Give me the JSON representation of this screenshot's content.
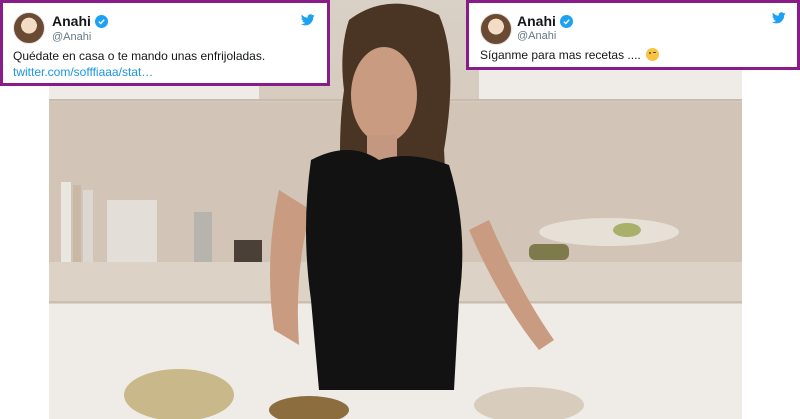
{
  "tweets": [
    {
      "name": "Anahi",
      "handle": "@Anahi",
      "text": "Quédate en casa o te mando unas enfrijoladas.",
      "link": "twitter.com/sofffiaaa/stat…"
    },
    {
      "name": "Anahi",
      "handle": "@Anahi",
      "text": "Síganme para mas recetas ....",
      "emoji": "relieved-face-emoji"
    }
  ],
  "colors": {
    "frame": "#8a1c8a",
    "twitter_blue": "#1da1f2",
    "link": "#1b95e0"
  },
  "icons": [
    "verified-badge-icon",
    "twitter-bird-icon"
  ]
}
